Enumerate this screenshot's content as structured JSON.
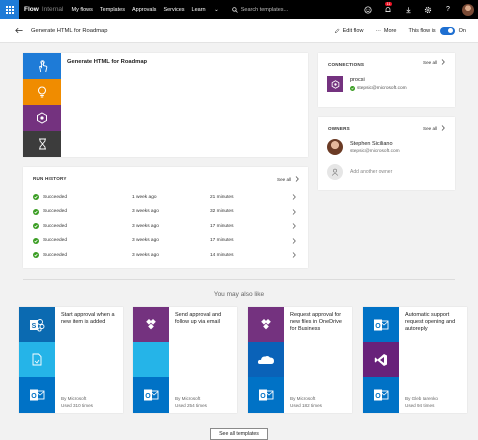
{
  "topnav": {
    "brand": "Flow",
    "brand_sub": "Internal",
    "links": [
      "My flows",
      "Templates",
      "Approvals",
      "Services",
      "Learn"
    ],
    "search_placeholder": "Search templates",
    "notification_count": "11"
  },
  "subbar": {
    "title": "Generate HTML for Roadmap",
    "edit_label": "Edit flow",
    "more_label": "More",
    "toggle_label": "This flow is",
    "toggle_state": "On"
  },
  "flow_card": {
    "title": "Generate HTML for Roadmap",
    "steps": [
      {
        "icon": "touch-icon",
        "color": "#1e7bd7"
      },
      {
        "icon": "lightbulb-icon",
        "color": "#f08c00"
      },
      {
        "icon": "hexagon-icon",
        "color": "#74327f"
      },
      {
        "icon": "hourglass-icon",
        "color": "#3c3c3c"
      }
    ]
  },
  "run_history": {
    "heading": "RUN HISTORY",
    "see_all": "See all",
    "rows": [
      {
        "status": "Succeeded",
        "when": "1 week ago",
        "duration": "21 minutes"
      },
      {
        "status": "Succeeded",
        "when": "3 weeks ago",
        "duration": "32 minutes"
      },
      {
        "status": "Succeeded",
        "when": "3 weeks ago",
        "duration": "17 minutes"
      },
      {
        "status": "Succeeded",
        "when": "3 weeks ago",
        "duration": "17 minutes"
      },
      {
        "status": "Succeeded",
        "when": "3 weeks ago",
        "duration": "14 minutes"
      }
    ]
  },
  "connections": {
    "heading": "CONNECTIONS",
    "see_all": "See all",
    "name": "procsi",
    "email": "stepsic@microsoft.com"
  },
  "owners": {
    "heading": "OWNERS",
    "see_all": "See all",
    "name": "Stephen Siciliano",
    "email": "stepsic@microsoft.com",
    "add_label": "Add another owner"
  },
  "also_like": "You may also like",
  "templates": [
    {
      "title": "Start approval when a new item is added",
      "by": "By Microsoft",
      "used": "Used 310 times",
      "icons": [
        {
          "icon": "sharepoint-icon",
          "color": "#0b6ab1"
        },
        {
          "icon": "document-icon",
          "color": "#25b4e8"
        },
        {
          "icon": "outlook-icon",
          "color": "#0072c6"
        }
      ]
    },
    {
      "title": "Send approval and follow up via email",
      "by": "By Microsoft",
      "used": "Used 254 times",
      "icons": [
        {
          "icon": "approvals-icon",
          "color": "#74327f"
        },
        {
          "icon": "blank-icon",
          "color": "#25b4e8"
        },
        {
          "icon": "outlook-icon",
          "color": "#0072c6"
        }
      ]
    },
    {
      "title": "Request approval for new files in OneDrive for Business",
      "by": "By Microsoft",
      "used": "Used 182 times",
      "icons": [
        {
          "icon": "approvals-icon",
          "color": "#74327f"
        },
        {
          "icon": "onedrive-icon",
          "color": "#0a62b8"
        },
        {
          "icon": "outlook-icon",
          "color": "#0072c6"
        }
      ]
    },
    {
      "title": "Automatic support request opening and autoreply",
      "by": "By Gleb Iarenko",
      "used": "Used 94 times",
      "icons": [
        {
          "icon": "outlook-icon",
          "color": "#0072c6"
        },
        {
          "icon": "visual-studio-icon",
          "color": "#68217a"
        },
        {
          "icon": "outlook-icon",
          "color": "#0072c6"
        }
      ]
    }
  ],
  "see_all_templates": "See all templates"
}
